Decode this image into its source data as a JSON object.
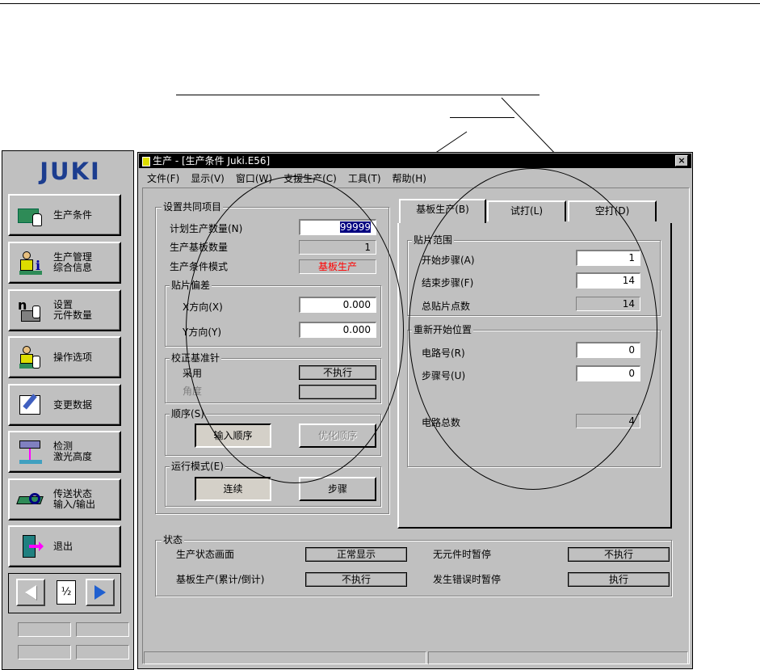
{
  "brand": {
    "logo_text": "JUKI"
  },
  "nav_items": [
    {
      "label": "生产条件",
      "icon": "pcb-board-hand-icon"
    },
    {
      "label": "生产管理\n综合信息",
      "icon": "operator-info-icon"
    },
    {
      "label": "设置\n元件数量",
      "icon": "component-count-icon"
    },
    {
      "label": "操作选项",
      "icon": "operator-options-icon"
    },
    {
      "label": "变更数据",
      "icon": "edit-pencil-icon"
    },
    {
      "label": "检测\n激光高度",
      "icon": "laser-height-icon"
    },
    {
      "label": "传送状态\n输入/输出",
      "icon": "conveyor-io-icon"
    },
    {
      "label": "退出",
      "icon": "exit-door-icon"
    }
  ],
  "pager": {
    "page": "½"
  },
  "window": {
    "title": "生产 - [生产条件 Juki.E56]",
    "close": "×",
    "menu": [
      "文件(F)",
      "显示(V)",
      "窗口(W)",
      "支援生产(C)",
      "工具(T)",
      "帮助(H)"
    ]
  },
  "common": {
    "title": "设置共同项目",
    "planned_qty_label": "计划生产数量(N)",
    "planned_qty_value": "99999",
    "board_qty_label": "生产基板数量",
    "board_qty_value": "1",
    "mode_label": "生产条件模式",
    "mode_value": "基板生产",
    "mode_color": "#ff0000",
    "offset": {
      "title": "贴片偏差",
      "x_label": "X方向(X)",
      "x_value": "0.000",
      "y_label": "Y方向(Y)",
      "y_value": "0.000"
    },
    "pin": {
      "title": "校正基准针",
      "use_label": "采用",
      "use_value": "不执行",
      "angle_label": "角度",
      "angle_value": ""
    },
    "order": {
      "title": "顺序(S)",
      "input_order": "输入顺序",
      "optimize_order": "优化顺序"
    },
    "run_mode": {
      "title": "运行模式(E)",
      "continuous": "连续",
      "step": "步骤"
    }
  },
  "tabs": [
    "基板生产(B)",
    "试打(L)",
    "空打(D)"
  ],
  "board_tab": {
    "range_title": "贴片范围",
    "start_label": "开始步骤(A)",
    "start_value": "1",
    "end_label": "结束步骤(F)",
    "end_value": "14",
    "total_label": "总贴片点数",
    "total_value": "14",
    "restart_title": "重新开始位置",
    "circuit_label": "电路号(R)",
    "circuit_value": "0",
    "step_label": "步骤号(U)",
    "step_value": "0",
    "circuit_total_label": "电路总数",
    "circuit_total_value": "4"
  },
  "status": {
    "title": "状态",
    "screen_label": "生产状态画面",
    "screen_value": "正常显示",
    "no_part_label": "无元件时暂停",
    "no_part_value": "不执行",
    "count_label": "基板生产(累计/倒计)",
    "count_value": "不执行",
    "error_label": "发生错误时暂停",
    "error_value": "执行"
  }
}
